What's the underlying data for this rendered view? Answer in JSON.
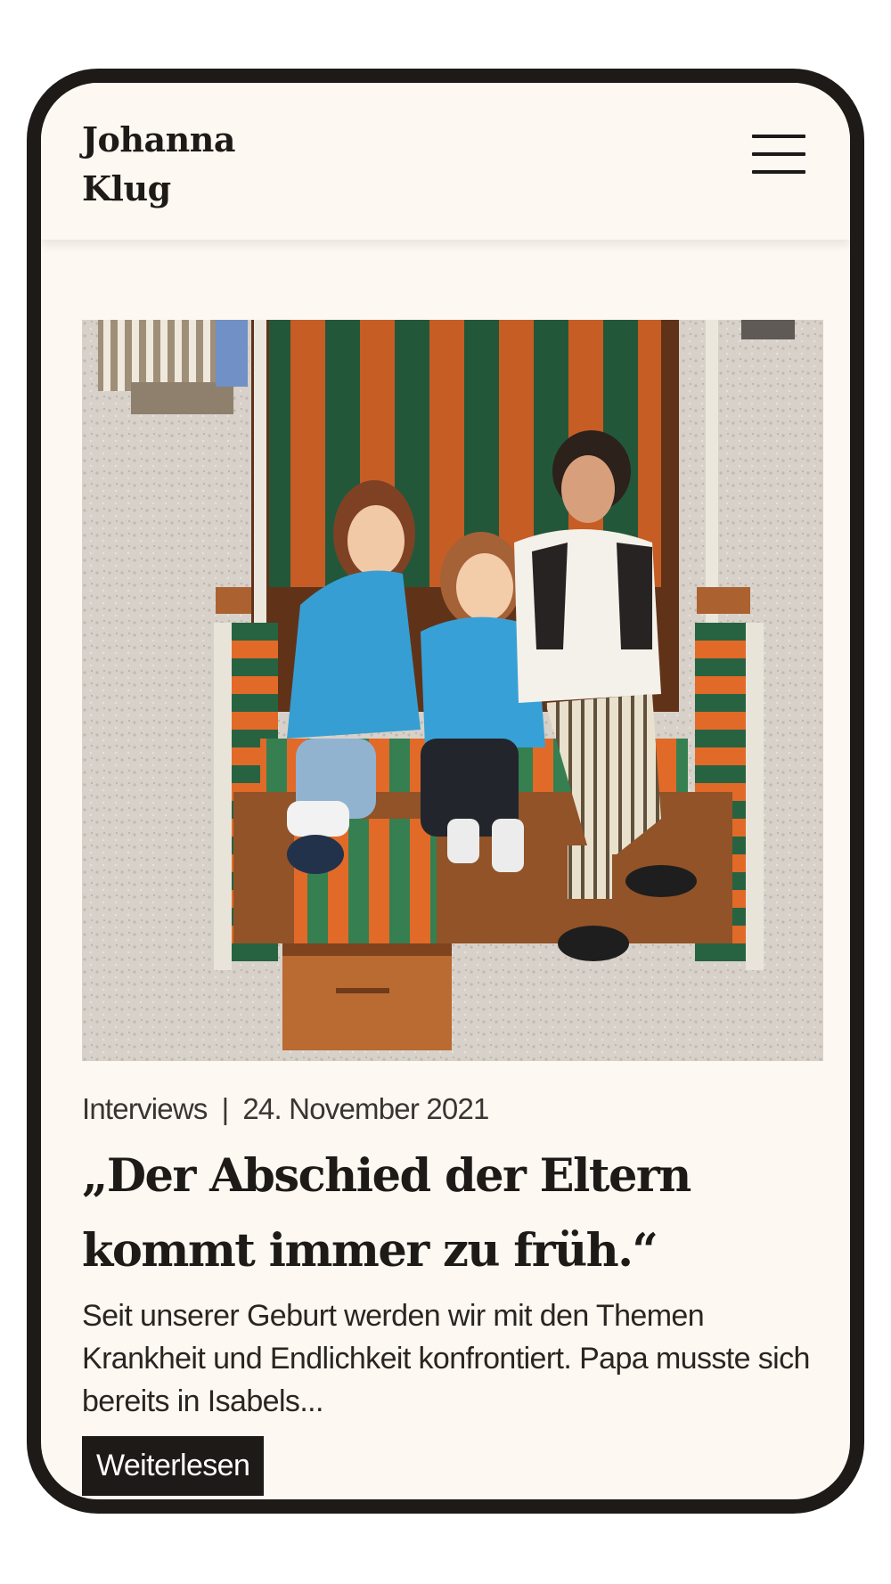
{
  "header": {
    "logo_line1": "Johanna",
    "logo_line2": "Klug",
    "menu_icon": "hamburger-menu-icon"
  },
  "post": {
    "image_alt": "Zwei Kinder in blauen Jacken und eine Frau sitzen in einem gestreiften Strandkorb am Strand",
    "category": "Interviews",
    "separator": "|",
    "date": "24. November 2021",
    "title": "„Der Abschied der Eltern kommt immer zu früh.“",
    "excerpt": "Seit unserer Geburt werden wir mit den Themen Krankheit und Endlichkeit konfrontiert. Papa musste sich bereits in Isabels...",
    "read_more_label": "Weiterlesen"
  },
  "colors": {
    "background": "#fdf8f1",
    "text": "#1e1a18",
    "frame": "#1e1a18",
    "button_bg": "#1e1a18",
    "button_text": "#ffffff"
  }
}
